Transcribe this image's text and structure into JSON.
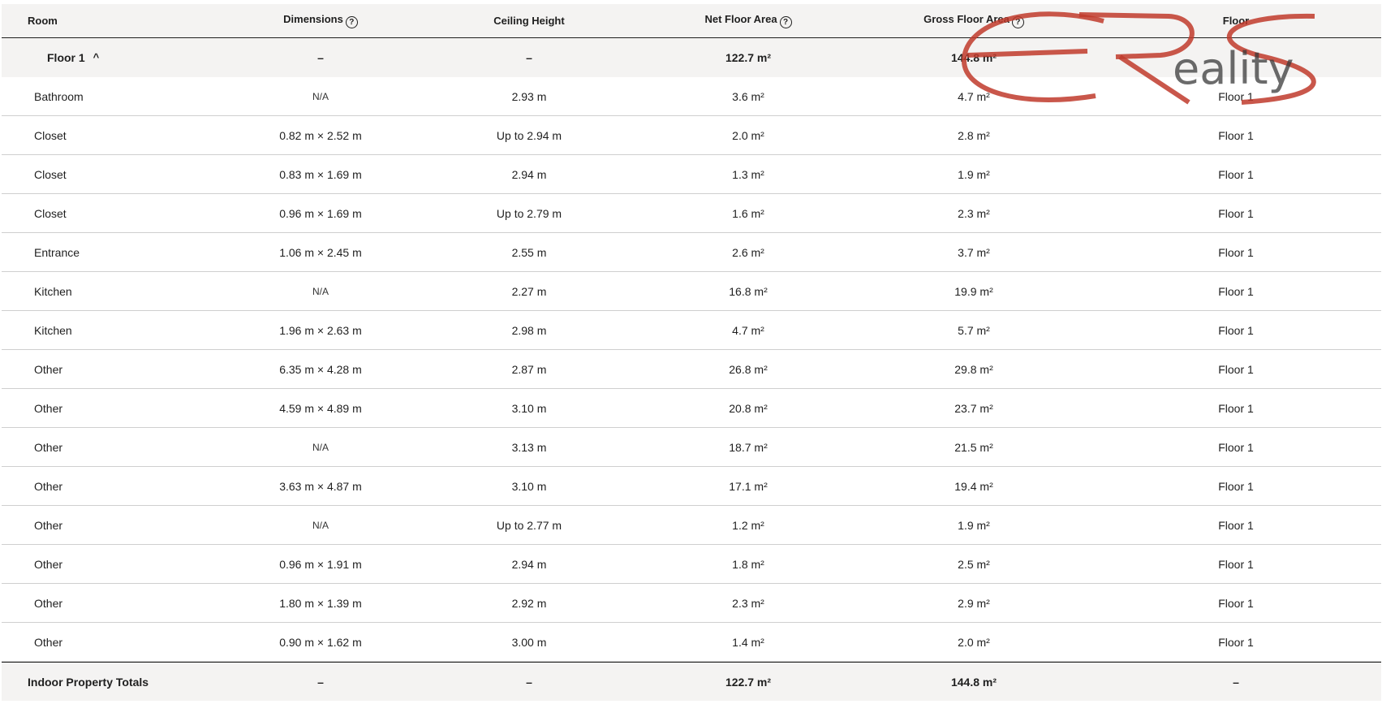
{
  "columns": {
    "room": "Room",
    "dimensions": "Dimensions",
    "ceiling": "Ceiling Height",
    "net": "Net Floor Area",
    "gross": "Gross Floor Area",
    "floor": "Floor"
  },
  "help_glyph": "?",
  "group": {
    "name": "Floor 1",
    "chevron": "^",
    "dimensions": "–",
    "ceiling": "–",
    "net": "122.7 m²",
    "gross": "144.8 m²"
  },
  "rows": [
    {
      "room": "Bathroom",
      "dimensions": "N/A",
      "ceiling": "2.93 m",
      "net": "3.6 m²",
      "gross": "4.7 m²",
      "floor": "Floor 1"
    },
    {
      "room": "Closet",
      "dimensions": "0.82 m × 2.52 m",
      "ceiling": "Up to 2.94 m",
      "net": "2.0 m²",
      "gross": "2.8 m²",
      "floor": "Floor 1"
    },
    {
      "room": "Closet",
      "dimensions": "0.83 m × 1.69 m",
      "ceiling": "2.94 m",
      "net": "1.3 m²",
      "gross": "1.9 m²",
      "floor": "Floor 1"
    },
    {
      "room": "Closet",
      "dimensions": "0.96 m × 1.69 m",
      "ceiling": "Up to 2.79 m",
      "net": "1.6 m²",
      "gross": "2.3 m²",
      "floor": "Floor 1"
    },
    {
      "room": "Entrance",
      "dimensions": "1.06 m × 2.45 m",
      "ceiling": "2.55 m",
      "net": "2.6 m²",
      "gross": "3.7 m²",
      "floor": "Floor 1"
    },
    {
      "room": "Kitchen",
      "dimensions": "N/A",
      "ceiling": "2.27 m",
      "net": "16.8 m²",
      "gross": "19.9 m²",
      "floor": "Floor 1"
    },
    {
      "room": "Kitchen",
      "dimensions": "1.96 m × 2.63 m",
      "ceiling": "2.98 m",
      "net": "4.7 m²",
      "gross": "5.7 m²",
      "floor": "Floor 1"
    },
    {
      "room": "Other",
      "dimensions": "6.35 m × 4.28 m",
      "ceiling": "2.87 m",
      "net": "26.8 m²",
      "gross": "29.8 m²",
      "floor": "Floor 1"
    },
    {
      "room": "Other",
      "dimensions": "4.59 m × 4.89 m",
      "ceiling": "3.10 m",
      "net": "20.8 m²",
      "gross": "23.7 m²",
      "floor": "Floor 1"
    },
    {
      "room": "Other",
      "dimensions": "N/A",
      "ceiling": "3.13 m",
      "net": "18.7 m²",
      "gross": "21.5 m²",
      "floor": "Floor 1"
    },
    {
      "room": "Other",
      "dimensions": "3.63 m × 4.87 m",
      "ceiling": "3.10 m",
      "net": "17.1 m²",
      "gross": "19.4 m²",
      "floor": "Floor 1"
    },
    {
      "room": "Other",
      "dimensions": "N/A",
      "ceiling": "Up to 2.77 m",
      "net": "1.2 m²",
      "gross": "1.9 m²",
      "floor": "Floor 1"
    },
    {
      "room": "Other",
      "dimensions": "0.96 m × 1.91 m",
      "ceiling": "2.94 m",
      "net": "1.8 m²",
      "gross": "2.5 m²",
      "floor": "Floor 1"
    },
    {
      "room": "Other",
      "dimensions": "1.80 m × 1.39 m",
      "ceiling": "2.92 m",
      "net": "2.3 m²",
      "gross": "2.9 m²",
      "floor": "Floor 1"
    },
    {
      "room": "Other",
      "dimensions": "0.90 m × 1.62 m",
      "ceiling": "3.00 m",
      "net": "1.4 m²",
      "gross": "2.0 m²",
      "floor": "Floor 1"
    }
  ],
  "totals": {
    "label": "Indoor Property Totals",
    "dimensions": "–",
    "ceiling": "–",
    "net": "122.7 m²",
    "gross": "144.8 m²",
    "floor": "–"
  },
  "watermark": {
    "text": "eality",
    "color": "#c0392b"
  }
}
